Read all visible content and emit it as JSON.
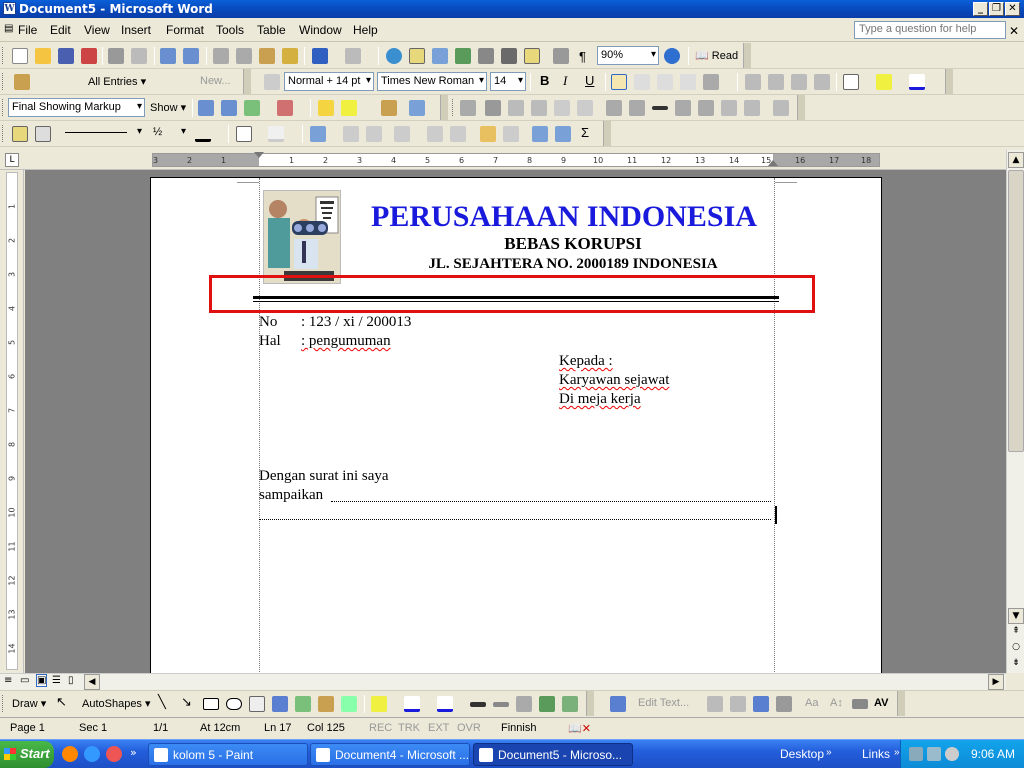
{
  "window": {
    "title": "Document5 - Microsoft Word",
    "app_icon": "W"
  },
  "menu": {
    "items": [
      "File",
      "Edit",
      "View",
      "Insert",
      "Format",
      "Tools",
      "Table",
      "Window",
      "Help"
    ],
    "help_placeholder": "Type a question for help"
  },
  "toolbar_standard": {
    "zoom": "90%",
    "read_label": "Read"
  },
  "toolbar_autotext": {
    "entries_label": "All Entries ▾",
    "new_label": "New...",
    "style": "Normal + 14 pt",
    "font": "Times New Roman",
    "size": "14"
  },
  "toolbar_reviewing": {
    "display": "Final Showing Markup",
    "show_label": "Show ▾"
  },
  "toolbar_tables": {
    "line_weight": "½"
  },
  "ruler": {
    "ticks": [
      "3",
      "2",
      "1",
      "1",
      "2",
      "3",
      "4",
      "5",
      "6",
      "7",
      "8",
      "9",
      "10",
      "11",
      "12",
      "13",
      "14",
      "15",
      "16",
      "17",
      "18"
    ],
    "vticks": [
      "1",
      "2",
      "3",
      "4",
      "5",
      "6",
      "7",
      "8",
      "9",
      "10",
      "11",
      "12",
      "13",
      "14"
    ]
  },
  "document": {
    "company": "PERUSAHAAN INDONESIA",
    "tagline": "BEBAS KORUPSI",
    "address": "JL. SEJAHTERA NO. 2000189 INDONESIA",
    "no_label": "No",
    "no_value": ": 123 / xi / 200013",
    "hal_label": "Hal",
    "hal_value": ": pengumuman",
    "to1": "Kepada :",
    "to2": "Karyawan sejawat",
    "to3": "Di meja kerja",
    "body1": "Dengan surat ini saya",
    "body2": "sampaikan"
  },
  "drawbar": {
    "draw_label": "Draw ▾",
    "autoshapes_label": "AutoShapes ▾",
    "edit_text": "Edit Text..."
  },
  "status": {
    "page": "Page 1",
    "sec": "Sec 1",
    "pages": "1/1",
    "at": "At 12cm",
    "ln": "Ln 17",
    "col": "Col 125",
    "rec": "REC",
    "trk": "TRK",
    "ext": "EXT",
    "ovr": "OVR",
    "lang": "Finnish"
  },
  "taskbar": {
    "start": "Start",
    "tasks": [
      "kolom 5 - Paint",
      "Document4 - Microsoft ...",
      "Document5 - Microso..."
    ],
    "desktop": "Desktop",
    "links": "Links",
    "clock": "9:06 AM"
  },
  "colors": {
    "title_blue": "#1a1adc",
    "highlight_red": "#e01010"
  }
}
